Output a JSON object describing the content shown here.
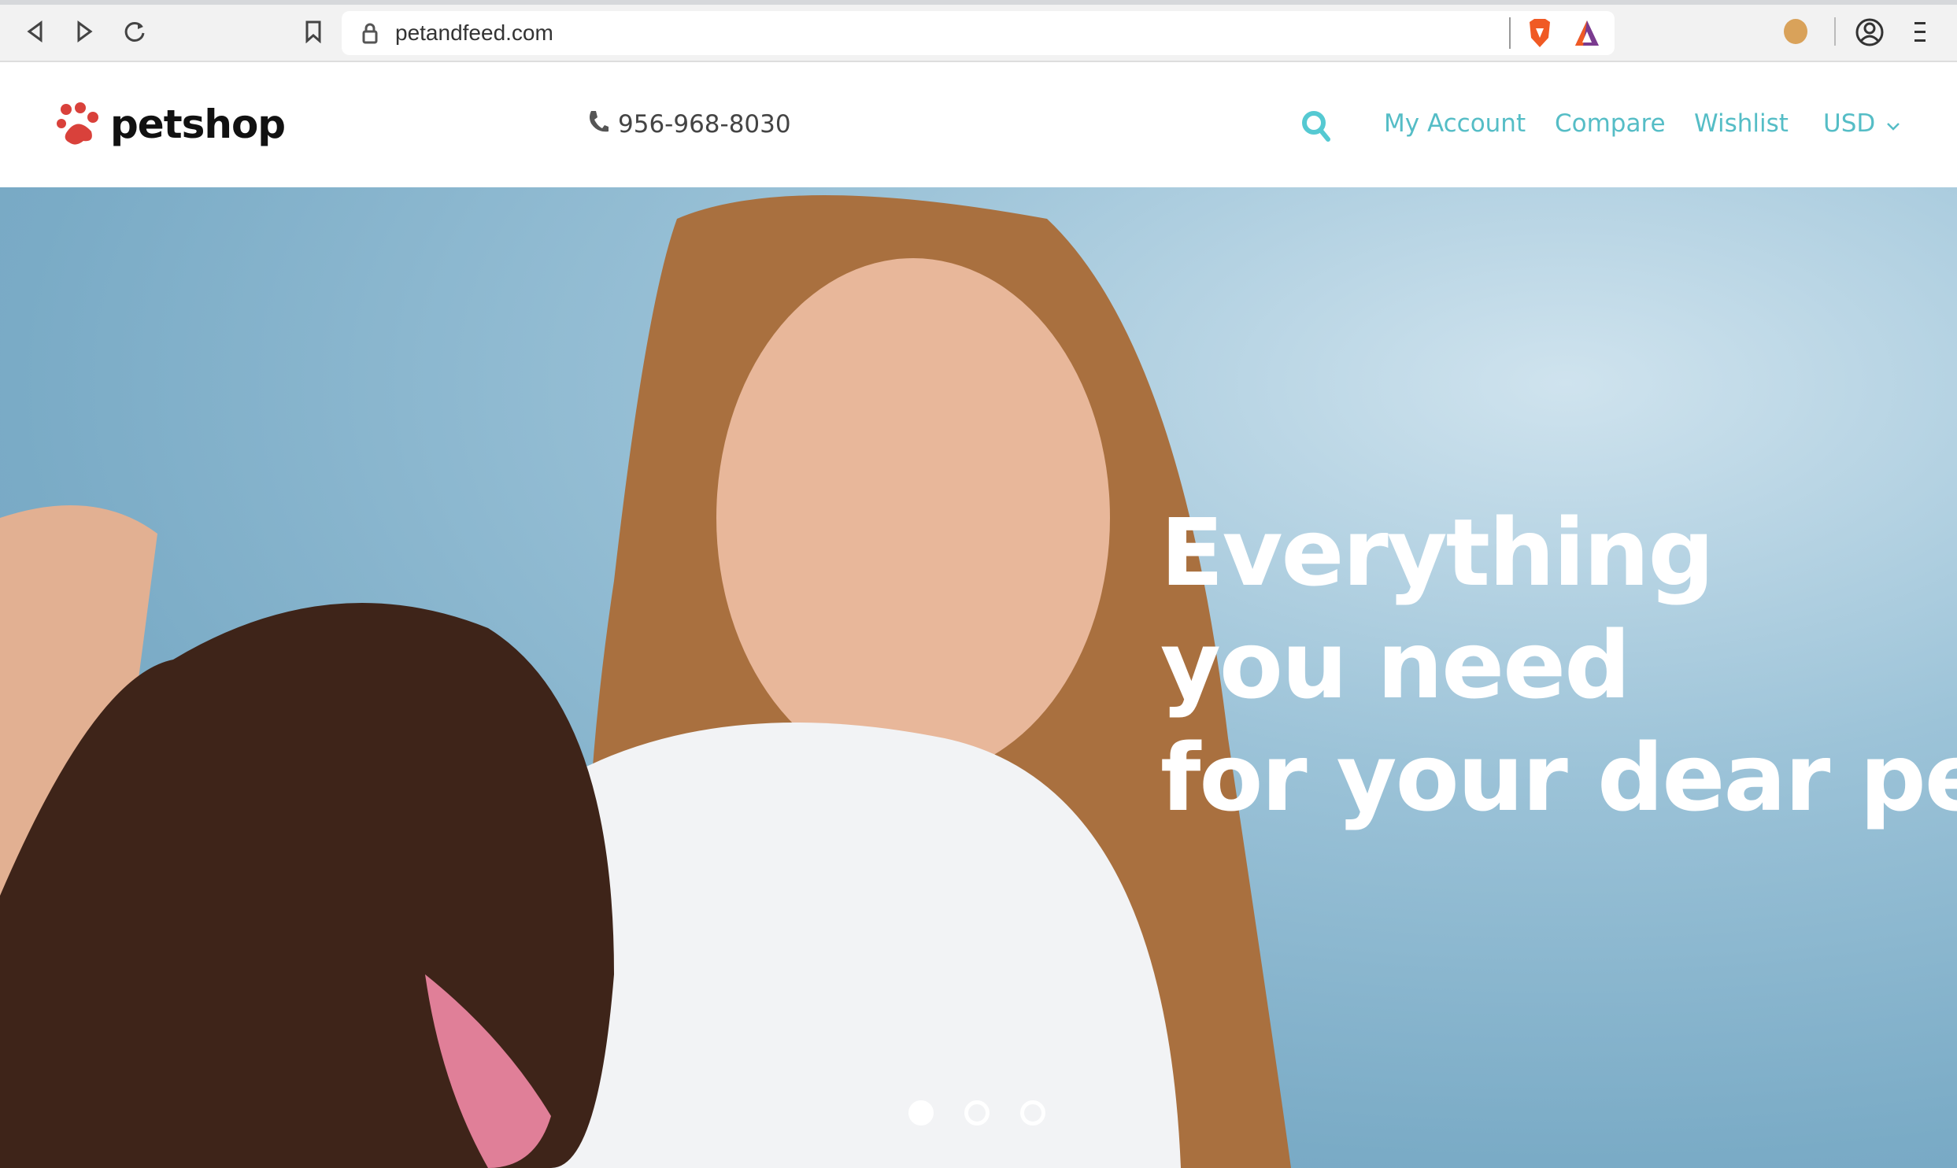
{
  "browser": {
    "url": "petandfeed.com"
  },
  "header": {
    "logo": "petshop",
    "phone": "956-968-8030",
    "nav": [
      "My Account",
      "Compare",
      "Wishlist"
    ],
    "currency": "USD",
    "accent": "#55bdc6"
  },
  "hero": {
    "lines": [
      "Everything",
      "you need",
      "for your dear pet"
    ],
    "slides": 3,
    "active_slide": 1
  }
}
